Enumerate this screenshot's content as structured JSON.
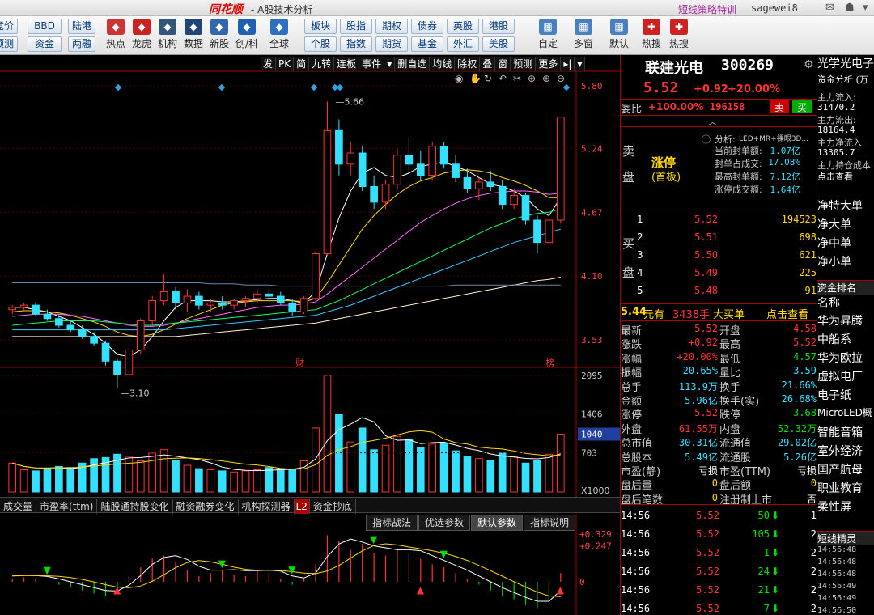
{
  "titlebar": {
    "logo": "同花顺",
    "title": "- A股技术分析",
    "promo": "短线策略特训",
    "user": "sagewei8"
  },
  "toolbar": {
    "small_buttons": [
      {
        "label": "竞价",
        "col": 0,
        "row": 0
      },
      {
        "label": "预测",
        "col": 0,
        "row": 1
      },
      {
        "label": "BBD",
        "col": 1,
        "row": 0
      },
      {
        "label": "资金",
        "col": 1,
        "row": 1
      },
      {
        "label": "陆港",
        "col": 2,
        "row": 0
      },
      {
        "label": "两融",
        "col": 2,
        "row": 1
      }
    ],
    "big_buttons": [
      "热点",
      "龙虎",
      "机构",
      "数据",
      "新股",
      "创/科",
      "全球"
    ],
    "grid_buttons": [
      [
        "板块",
        "股指",
        "期权",
        "债券",
        "英股",
        "港股"
      ],
      [
        "个股",
        "指数",
        "期货",
        "基金",
        "外汇",
        "美股"
      ]
    ],
    "right_buttons": [
      "自定",
      "多窗",
      "默认",
      "热搜",
      "热搜"
    ]
  },
  "chart_tools": [
    "发",
    "PK",
    "简",
    "九转",
    "连板",
    "事件",
    "▾",
    "删自选",
    "均线",
    "除权",
    "叠",
    "窗",
    "预测",
    "更多",
    "▸|",
    "▾"
  ],
  "chart_data": [
    {
      "type": "candlestick",
      "title": "",
      "y_ticks": [
        "5.80",
        "5.24",
        "4.67",
        "4.10",
        "3.53"
      ],
      "annotations": {
        "high": "5.66",
        "low": "3.10",
        "marker_fin": "财",
        "marker_rank": "榜"
      },
      "candles_ohlc": [
        [
          3.8,
          3.84,
          3.76,
          3.82
        ],
        [
          3.82,
          3.86,
          3.78,
          3.84
        ],
        [
          3.84,
          3.86,
          3.74,
          3.76
        ],
        [
          3.76,
          3.8,
          3.7,
          3.72
        ],
        [
          3.72,
          3.76,
          3.64,
          3.66
        ],
        [
          3.66,
          3.7,
          3.6,
          3.62
        ],
        [
          3.62,
          3.66,
          3.54,
          3.56
        ],
        [
          3.56,
          3.6,
          3.48,
          3.5
        ],
        [
          3.5,
          3.52,
          3.3,
          3.34
        ],
        [
          3.34,
          3.36,
          3.1,
          3.22
        ],
        [
          3.22,
          3.46,
          3.2,
          3.44
        ],
        [
          3.44,
          3.72,
          3.4,
          3.7
        ],
        [
          3.7,
          3.92,
          3.66,
          3.88
        ],
        [
          3.88,
          4.12,
          3.84,
          3.96
        ],
        [
          3.96,
          4.0,
          3.8,
          3.86
        ],
        [
          3.86,
          3.98,
          3.78,
          3.92
        ],
        [
          3.92,
          3.96,
          3.8,
          3.84
        ],
        [
          3.84,
          3.9,
          3.78,
          3.86
        ],
        [
          3.86,
          3.92,
          3.8,
          3.84
        ],
        [
          3.84,
          3.9,
          3.8,
          3.88
        ],
        [
          3.88,
          3.92,
          3.82,
          3.9
        ],
        [
          3.9,
          3.98,
          3.86,
          3.94
        ],
        [
          3.94,
          3.98,
          3.88,
          3.92
        ],
        [
          3.92,
          3.96,
          3.84,
          3.86
        ],
        [
          3.86,
          3.9,
          3.74,
          3.78
        ],
        [
          3.78,
          3.92,
          3.76,
          3.9
        ],
        [
          3.9,
          4.32,
          3.88,
          4.3
        ],
        [
          4.3,
          5.66,
          4.28,
          5.4
        ],
        [
          5.4,
          5.5,
          5.0,
          5.1
        ],
        [
          5.1,
          5.3,
          5.0,
          5.2
        ],
        [
          5.2,
          5.26,
          4.86,
          4.9
        ],
        [
          4.9,
          5.0,
          4.7,
          4.76
        ],
        [
          4.76,
          4.96,
          4.7,
          4.92
        ],
        [
          4.92,
          5.24,
          4.88,
          5.18
        ],
        [
          5.18,
          5.34,
          5.04,
          5.1
        ],
        [
          5.1,
          5.22,
          4.96,
          5.0
        ],
        [
          5.0,
          5.3,
          4.96,
          5.26
        ],
        [
          5.26,
          5.3,
          5.06,
          5.1
        ],
        [
          5.1,
          5.18,
          4.94,
          4.98
        ],
        [
          4.98,
          5.06,
          4.84,
          4.88
        ],
        [
          4.88,
          4.98,
          4.78,
          4.94
        ],
        [
          4.94,
          5.04,
          4.86,
          4.9
        ],
        [
          4.9,
          4.96,
          4.7,
          4.74
        ],
        [
          4.74,
          4.88,
          4.7,
          4.82
        ],
        [
          4.82,
          4.84,
          4.56,
          4.6
        ],
        [
          4.6,
          4.64,
          4.3,
          4.4
        ],
        [
          4.4,
          4.6,
          4.38,
          4.6
        ],
        [
          4.6,
          5.52,
          4.57,
          5.52
        ]
      ],
      "ma_lines": [
        {
          "color": "#ffffff",
          "values": [
            3.82,
            3.82,
            3.8,
            3.78,
            3.74,
            3.7,
            3.64,
            3.58,
            3.5,
            3.4,
            3.38,
            3.44,
            3.56,
            3.7,
            3.82,
            3.88,
            3.88,
            3.88,
            3.87,
            3.87,
            3.88,
            3.89,
            3.9,
            3.9,
            3.88,
            3.86,
            3.96,
            4.3,
            4.62,
            4.86,
            5.02,
            5.07,
            5.0,
            4.98,
            5.02,
            5.08,
            5.1,
            5.12,
            5.08,
            5.04,
            4.98,
            4.92,
            4.9,
            4.86,
            4.8,
            4.7,
            4.64,
            4.8
          ]
        },
        {
          "color": "#ffd700",
          "values": [
            3.78,
            3.79,
            3.79,
            3.78,
            3.77,
            3.75,
            3.72,
            3.69,
            3.65,
            3.6,
            3.57,
            3.56,
            3.58,
            3.62,
            3.67,
            3.72,
            3.76,
            3.8,
            3.84,
            3.86,
            3.87,
            3.88,
            3.88,
            3.88,
            3.88,
            3.87,
            3.9,
            4.04,
            4.2,
            4.36,
            4.52,
            4.64,
            4.74,
            4.83,
            4.9,
            4.95,
            4.98,
            5.02,
            5.04,
            5.05,
            5.04,
            5.02,
            4.98,
            4.95,
            4.91,
            4.86,
            4.8,
            4.8
          ]
        },
        {
          "color": "#ff66ff",
          "values": [
            3.74,
            3.75,
            3.76,
            3.76,
            3.76,
            3.75,
            3.74,
            3.72,
            3.7,
            3.68,
            3.66,
            3.65,
            3.65,
            3.66,
            3.68,
            3.7,
            3.72,
            3.74,
            3.76,
            3.78,
            3.8,
            3.82,
            3.83,
            3.84,
            3.84,
            3.85,
            3.87,
            3.94,
            4.02,
            4.1,
            4.18,
            4.26,
            4.34,
            4.42,
            4.5,
            4.58,
            4.64,
            4.7,
            4.75,
            4.79,
            4.82,
            4.84,
            4.85,
            4.86,
            4.86,
            4.85,
            4.83,
            4.84
          ]
        },
        {
          "color": "#00ff66",
          "values": [
            3.66,
            3.67,
            3.68,
            3.69,
            3.7,
            3.7,
            3.7,
            3.7,
            3.69,
            3.68,
            3.67,
            3.66,
            3.66,
            3.67,
            3.68,
            3.69,
            3.7,
            3.71,
            3.72,
            3.73,
            3.74,
            3.75,
            3.76,
            3.77,
            3.78,
            3.79,
            3.8,
            3.84,
            3.88,
            3.93,
            3.98,
            4.03,
            4.08,
            4.13,
            4.18,
            4.23,
            4.28,
            4.33,
            4.38,
            4.43,
            4.48,
            4.53,
            4.57,
            4.61,
            4.64,
            4.66,
            4.67,
            4.7
          ]
        },
        {
          "color": "#33ccff",
          "values": [
            3.62,
            3.62,
            3.62,
            3.62,
            3.62,
            3.62,
            3.62,
            3.62,
            3.62,
            3.62,
            3.62,
            3.62,
            3.62,
            3.62,
            3.63,
            3.64,
            3.65,
            3.66,
            3.67,
            3.68,
            3.69,
            3.7,
            3.71,
            3.72,
            3.73,
            3.74,
            3.75,
            3.78,
            3.81,
            3.84,
            3.88,
            3.92,
            3.96,
            4.0,
            4.04,
            4.08,
            4.12,
            4.16,
            4.2,
            4.24,
            4.28,
            4.32,
            4.36,
            4.4,
            4.43,
            4.46,
            4.49,
            4.52
          ]
        },
        {
          "color": "#ffeecc",
          "values": [
            3.56,
            3.56,
            3.56,
            3.56,
            3.56,
            3.56,
            3.56,
            3.56,
            3.56,
            3.56,
            3.56,
            3.56,
            3.56,
            3.56,
            3.56,
            3.57,
            3.58,
            3.59,
            3.6,
            3.61,
            3.62,
            3.63,
            3.64,
            3.65,
            3.66,
            3.67,
            3.68,
            3.7,
            3.72,
            3.74,
            3.76,
            3.78,
            3.8,
            3.82,
            3.84,
            3.86,
            3.88,
            3.9,
            3.92,
            3.94,
            3.96,
            3.98,
            4.0,
            4.02,
            4.04,
            4.06,
            4.07,
            4.09
          ]
        },
        {
          "color": "#6688aa",
          "values": [
            4.04,
            4.04,
            4.04,
            4.04,
            4.04,
            4.04,
            4.04,
            4.04,
            4.04,
            4.04,
            4.04,
            4.04,
            4.04,
            4.04,
            4.04,
            4.04,
            4.04,
            4.03,
            4.03,
            4.03,
            4.02,
            4.02,
            4.02,
            4.01,
            4.01,
            4.01,
            4.01,
            4.01,
            4.01,
            4.01,
            4.01,
            4.01,
            4.01,
            4.01,
            4.01,
            4.01,
            4.01,
            4.01,
            4.02,
            4.02,
            4.02,
            4.02,
            4.02,
            4.02,
            4.02,
            4.02,
            4.02,
            4.02
          ]
        }
      ]
    },
    {
      "type": "bar",
      "name": "volume",
      "y_ticks": [
        "2095",
        "1406",
        "703",
        "X1000"
      ],
      "current_value": "1040",
      "values": [
        520,
        400,
        380,
        420,
        460,
        440,
        520,
        600,
        620,
        680,
        640,
        560,
        700,
        760,
        560,
        480,
        420,
        400,
        380,
        360,
        380,
        400,
        440,
        420,
        400,
        560,
        1150,
        2095,
        1400,
        900,
        1150,
        760,
        840,
        1000,
        940,
        800,
        860,
        880,
        740,
        640,
        600,
        560,
        700,
        640,
        520,
        560,
        680,
        1040
      ]
    },
    {
      "type": "bar",
      "name": "indicator",
      "y_ticks": [
        "+0.329",
        "+0.247",
        "0"
      ],
      "values": [
        0.02,
        0.03,
        0.02,
        0.0,
        -0.02,
        -0.04,
        -0.06,
        -0.08,
        -0.1,
        -0.07,
        0.04,
        0.1,
        0.16,
        0.18,
        0.14,
        0.08,
        0.04,
        0.06,
        0.08,
        0.05,
        0.04,
        0.08,
        0.06,
        0.02,
        -0.02,
        0.02,
        0.12,
        0.32,
        0.28,
        0.22,
        0.26,
        0.2,
        0.18,
        0.22,
        0.2,
        0.16,
        0.12,
        0.1,
        0.06,
        0.02,
        -0.02,
        -0.06,
        -0.1,
        -0.12,
        -0.16,
        -0.18,
        -0.12,
        0.06
      ]
    }
  ],
  "chart_icons": [
    "eye-icon",
    "hand-icon",
    "refresh-icon",
    "undo-icon",
    "scissors-icon",
    "crosshair-icon",
    "zoom-in-icon",
    "zoom-out-icon"
  ],
  "indicator_tabs": [
    "成交量",
    "市盈率(ttm)",
    "陆股通持股变化",
    "融资融券变化",
    "机构探测器",
    "资金抄底"
  ],
  "indicator_badge": "L2",
  "strategy_tabs": [
    "指标战法",
    "优选参数",
    "默认参数",
    "指标说明"
  ],
  "quote": {
    "name": "联建光电",
    "code": "300269",
    "price": "5.52",
    "change": "+0.92",
    "pct": "+20.00%",
    "weibi_label": "委比",
    "weibi": "+100.00%",
    "weicha": "196158",
    "sell_btn": "卖",
    "buy_btn": "买",
    "sell_label": [
      "卖",
      "盘"
    ],
    "buy_label": [
      "买",
      "盘"
    ],
    "limit_label": "涨停",
    "limit_sub": "(首板)",
    "analysis_label": "分析:",
    "analysis_text": "LED+MR+裸眼3D...",
    "seal_rows": [
      {
        "k": "当前封单额:",
        "v": "1.07亿"
      },
      {
        "k": "封单占成交:",
        "v": "17.08%"
      },
      {
        "k": "最高封单额:",
        "v": "7.12亿"
      },
      {
        "k": "涨停成交额:",
        "v": "1.64亿"
      }
    ],
    "bids": [
      {
        "n": "1",
        "p": "5.52",
        "v": "194523"
      },
      {
        "n": "2",
        "p": "5.51",
        "v": "698"
      },
      {
        "n": "3",
        "p": "5.50",
        "v": "621"
      },
      {
        "n": "4",
        "p": "5.49",
        "p2": "5.49",
        "v": "225"
      },
      {
        "n": "5",
        "p": "5.48",
        "v": "91"
      }
    ],
    "bigorder": {
      "price": "5.44",
      "unit": "元有",
      "hands": "3438手",
      "text": "大买单",
      "link": "点击查看"
    },
    "stats": [
      [
        "最新",
        "5.52",
        "开盘",
        "4.58"
      ],
      [
        "涨跌",
        "+0.92",
        "最高",
        "5.52"
      ],
      [
        "涨幅",
        "+20.00%",
        "最低",
        "4.57"
      ],
      [
        "振幅",
        "20.65%",
        "量比",
        "3.59"
      ],
      [
        "总手",
        "113.9万",
        "换手",
        "21.66%"
      ],
      [
        "金额",
        "5.96亿",
        "换手(实)",
        "26.68%"
      ],
      [
        "涨停",
        "5.52",
        "跌停",
        "3.68"
      ],
      [
        "外盘",
        "61.55万",
        "内盘",
        "52.32万"
      ],
      [
        "总市值",
        "30.31亿",
        "流通值",
        "29.02亿"
      ],
      [
        "总股本",
        "5.49亿",
        "流通股",
        "5.26亿"
      ],
      [
        "市盈(静)",
        "亏损",
        "市盈(TTM)",
        "亏损"
      ],
      [
        "盘后量",
        "0",
        "盘后额",
        "0"
      ],
      [
        "盘后笔数",
        "0",
        "注册制上市",
        "否"
      ]
    ],
    "ticks": [
      {
        "t": "14:56",
        "p": "5.52",
        "v": "50",
        "n": "1"
      },
      {
        "t": "14:56",
        "p": "5.52",
        "v": "105",
        "n": "2"
      },
      {
        "t": "14:56",
        "p": "5.52",
        "v": "1",
        "n": "2"
      },
      {
        "t": "14:56",
        "p": "5.52",
        "v": "24",
        "n": "2"
      },
      {
        "t": "14:56",
        "p": "5.52",
        "v": "21",
        "n": "2"
      },
      {
        "t": "14:56",
        "p": "5.52",
        "v": "7",
        "n": "2"
      }
    ]
  },
  "side": {
    "title": "光学光电子",
    "fund_label": "资金分析 (万",
    "fund_rows": [
      {
        "k": "主力流入:",
        "v": "31470.2",
        "c": "red"
      },
      {
        "k": "主力流出:",
        "v": "18164.4",
        "c": "green"
      },
      {
        "k": "主力净流入",
        "v": "13305.7",
        "c": "red"
      },
      {
        "k": "主力持仓成本",
        "v": "点击查看",
        "c": "cyan"
      }
    ],
    "net_items": [
      "净特大单",
      "净大单",
      "净中单",
      "净小单"
    ],
    "rank_label": "资金排名",
    "rank_header": "名称",
    "rank_items": [
      "华为昇腾",
      "中船系",
      "华为欧拉",
      "虚拟电厂",
      "电子纸",
      "MicroLED概",
      "智能音箱",
      "室外经济",
      "国产航母",
      "职业教育",
      "柔性屏"
    ],
    "short_label": "短线精灵",
    "short_times": [
      "14:56:48",
      "14:56:48",
      "14:56:48",
      "14:56:49",
      "14:56:49",
      "14:56:50"
    ]
  }
}
